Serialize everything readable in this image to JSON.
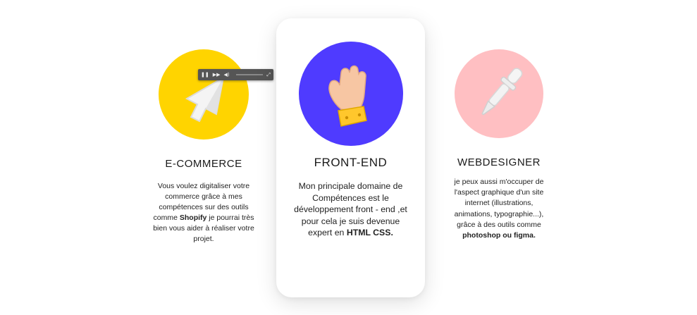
{
  "cards": [
    {
      "title": "E-COMMERCE",
      "desc_parts": [
        "Vous voulez digitaliser votre commerce grâce à mes compétences sur des outils comme ",
        "Shopify",
        " je pourrai très bien vous aider à réaliser votre projet."
      ],
      "color": "#FFD400"
    },
    {
      "title": "FRONT-END",
      "desc_parts": [
        "Mon principale domaine de Compétences est le développement front - end ,et pour cela je suis devenue expert en ",
        "HTML CSS."
      ],
      "color": "#4F3BFF"
    },
    {
      "title": "WEBDESIGNER",
      "desc_parts": [
        "je peux aussi m'occuper de l'aspect graphique d'un site internet (illustrations, animations, typographie...), grâce à des outils comme ",
        "photoshop ou figma."
      ],
      "color": "#FFBFC2"
    }
  ]
}
